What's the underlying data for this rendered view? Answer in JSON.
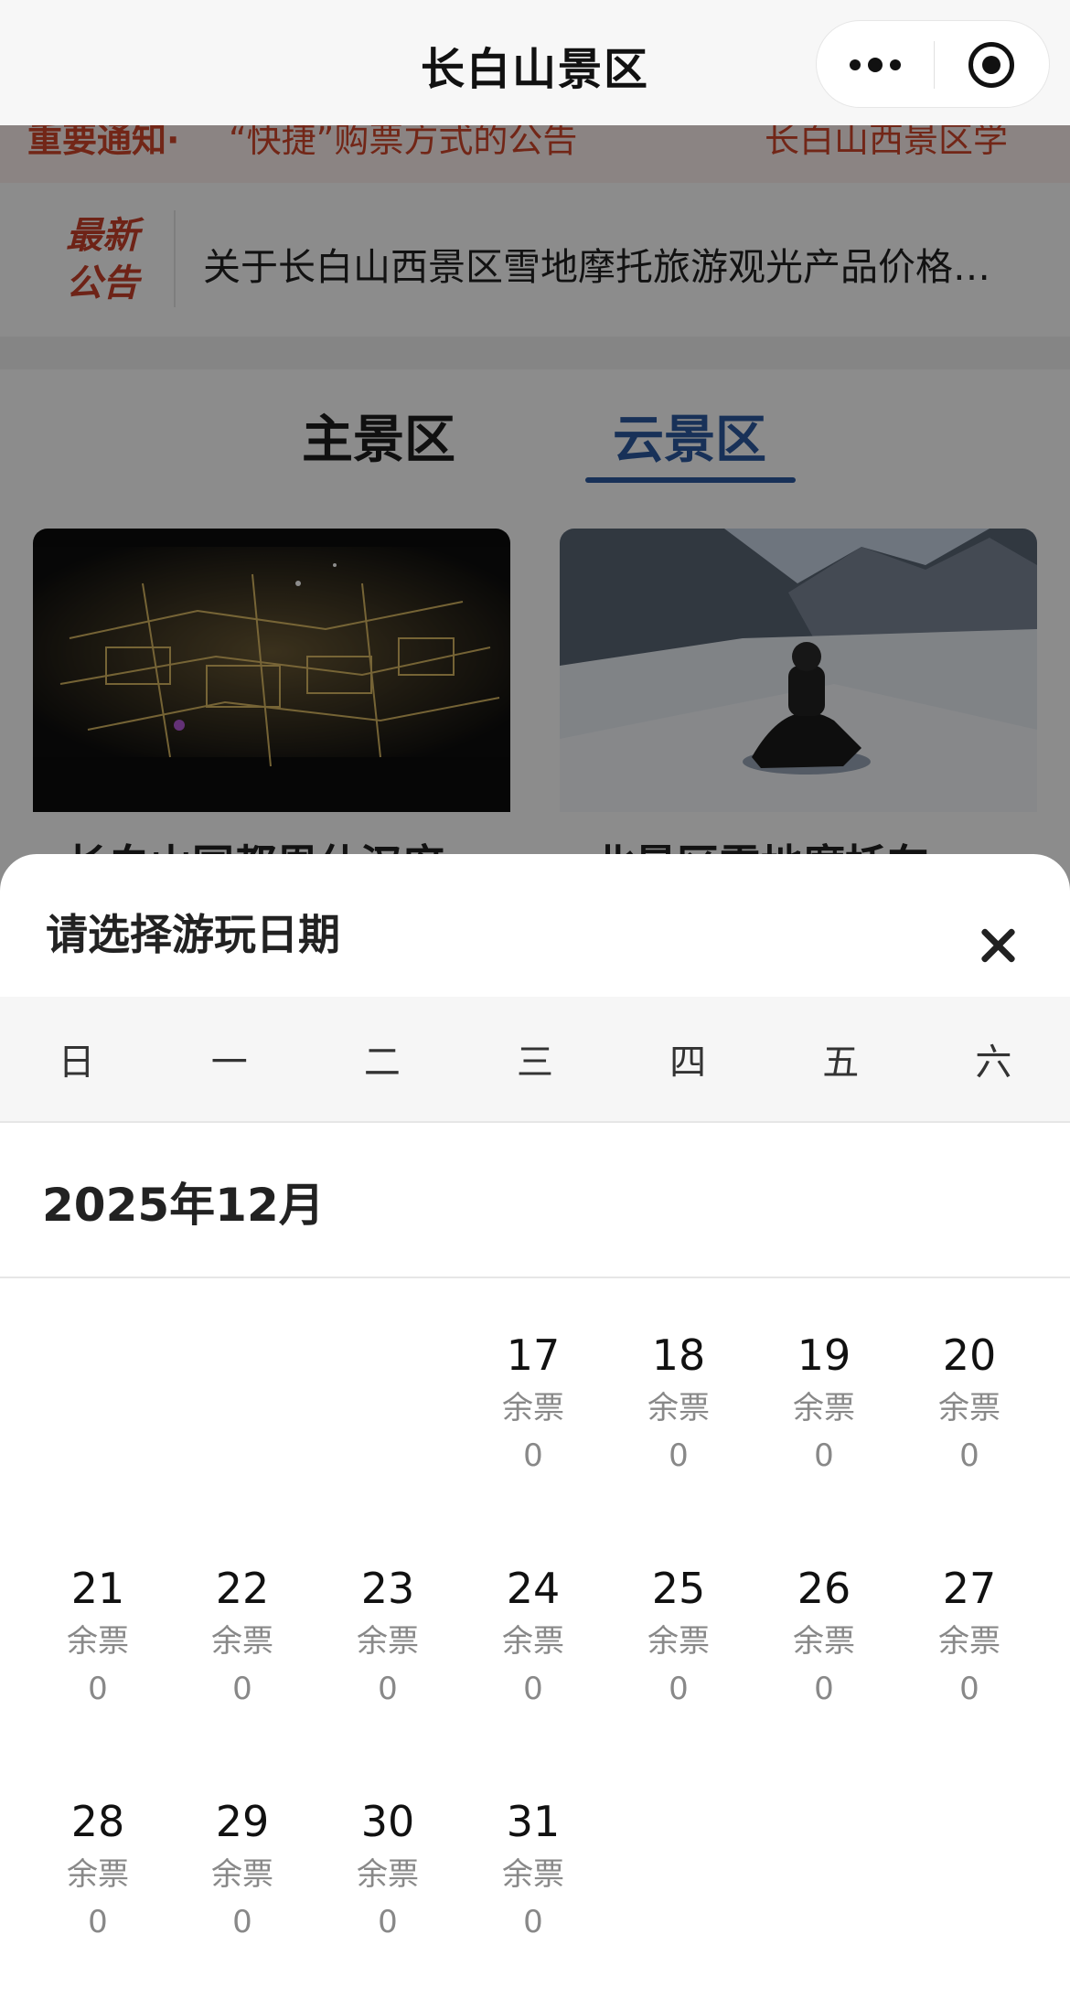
{
  "nav": {
    "title": "长白山景区"
  },
  "notice_strip": {
    "label": "重要通知·",
    "text": "“快捷”购票方式的公告",
    "right_text": "长白山西景区学"
  },
  "announcement": {
    "badge_line1": "最新",
    "badge_line2": "公告",
    "text": "关于长白山西景区雪地摩托旅游观光产品价格…"
  },
  "tabs": [
    {
      "label": "主景区",
      "active": false
    },
    {
      "label": "云景区",
      "active": true
    }
  ],
  "cards": [
    {
      "caption": "长白山国都恩仕汉府"
    },
    {
      "caption": "北景区雪地摩托车"
    }
  ],
  "date_sheet": {
    "title": "请选择游玩日期",
    "weekdays": [
      "日",
      "一",
      "二",
      "三",
      "四",
      "五",
      "六"
    ],
    "month_label": "2025年12月",
    "remaining_label": "余票",
    "days": [
      {
        "day": "17",
        "remaining_label": "余票",
        "count": "0"
      },
      {
        "day": "18",
        "remaining_label": "余票",
        "count": "0"
      },
      {
        "day": "19",
        "remaining_label": "余票",
        "count": "0"
      },
      {
        "day": "20",
        "remaining_label": "余票",
        "count": "0"
      },
      {
        "day": "21",
        "remaining_label": "余票",
        "count": "0"
      },
      {
        "day": "22",
        "remaining_label": "余票",
        "count": "0"
      },
      {
        "day": "23",
        "remaining_label": "余票",
        "count": "0"
      },
      {
        "day": "24",
        "remaining_label": "余票",
        "count": "0"
      },
      {
        "day": "25",
        "remaining_label": "余票",
        "count": "0"
      },
      {
        "day": "26",
        "remaining_label": "余票",
        "count": "0"
      },
      {
        "day": "27",
        "remaining_label": "余票",
        "count": "0"
      },
      {
        "day": "28",
        "remaining_label": "余票",
        "count": "0"
      },
      {
        "day": "29",
        "remaining_label": "余票",
        "count": "0"
      },
      {
        "day": "30",
        "remaining_label": "余票",
        "count": "0"
      },
      {
        "day": "31",
        "remaining_label": "余票",
        "count": "0"
      }
    ]
  },
  "colors": {
    "accent_blue": "#2c5aa0",
    "notice_red": "#c8402a"
  }
}
